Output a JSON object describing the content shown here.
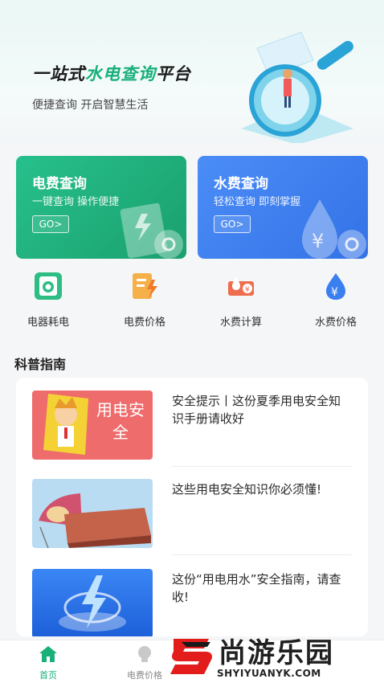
{
  "hero": {
    "title_prefix": "一站式",
    "title_highlight": "水电查询",
    "title_suffix": "平台",
    "subtitle": "便捷查询 开启智慧生活"
  },
  "cards": [
    {
      "title": "电费查询",
      "subtitle": "一键查询 操作便捷",
      "go": "GO>",
      "color": "#22b37f"
    },
    {
      "title": "水费查询",
      "subtitle": "轻松查询 即刻掌握",
      "go": "GO>",
      "color": "#4282f0"
    }
  ],
  "quick_actions": [
    {
      "label": "电器耗电",
      "icon": "appliance-icon"
    },
    {
      "label": "电费价格",
      "icon": "electric-price-icon"
    },
    {
      "label": "水费计算",
      "icon": "water-calc-icon"
    },
    {
      "label": "水费价格",
      "icon": "water-price-icon"
    }
  ],
  "section": {
    "title": "科普指南"
  },
  "articles": [
    {
      "text": "安全提示丨这份夏季用电安全知识手册请收好",
      "image_text": "用电安全"
    },
    {
      "text": "这些用电安全知识你必须懂!"
    },
    {
      "text": "这份“用电用水”安全指南，请查收!"
    }
  ],
  "tabbar": [
    {
      "label": "首页",
      "icon": "home-icon",
      "active": true
    },
    {
      "label": "电费价格",
      "icon": "bulb-icon",
      "active": false
    }
  ],
  "watermark": {
    "text": "尚游乐园",
    "url": "SHYIYUANYK.COM"
  },
  "colors": {
    "accent": "#19b07a",
    "blue": "#3f7ff0"
  }
}
